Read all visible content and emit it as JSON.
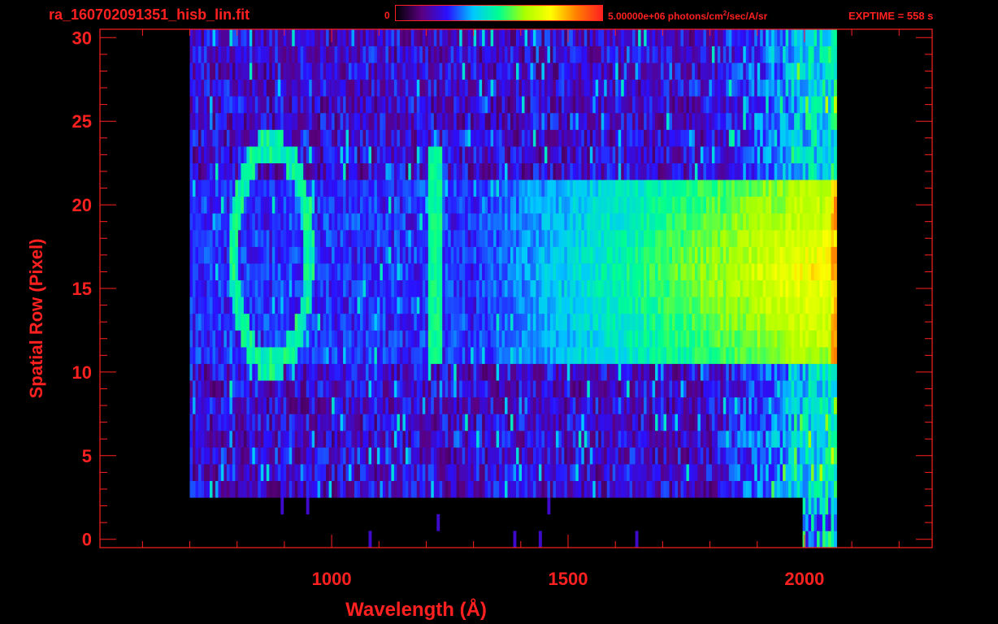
{
  "header": {
    "file_title": "ra_160702091351_hisb_lin.fit",
    "colorbar_min": "0",
    "colorbar_max_prefix": "5.00000e+06 photons/cm",
    "colorbar_max_sup": "2",
    "colorbar_max_suffix": "/sec/A/sr",
    "exptime": "EXPTIME = 558 s"
  },
  "colors": {
    "background": "#000000",
    "axes": "#ff2020",
    "colormap": [
      "#000000",
      "#5a0080",
      "#2a10ff",
      "#00c8ff",
      "#00ff90",
      "#aaff00",
      "#ffff00",
      "#ff8000",
      "#ff2020"
    ]
  },
  "chart_data": {
    "type": "heatmap",
    "title": "ra_160702091351_hisb_lin.fit",
    "xlabel": "Wavelength (Å)",
    "ylabel": "Spatial Row (Pixel)",
    "xlim": [
      510,
      2270
    ],
    "ylim": [
      -0.5,
      30.5
    ],
    "x_ticks": [
      1000,
      1500,
      2000
    ],
    "y_ticks": [
      0,
      5,
      10,
      15,
      20,
      25,
      30
    ],
    "colorbar": {
      "min": 0,
      "max": 5000000,
      "units": "photons/cm^2/sec/A/sr"
    },
    "signal_rows": [
      11,
      21
    ],
    "noise_rows": [
      3,
      30
    ],
    "data_start_wavelength": 700,
    "data_end_wavelength": 2065,
    "lines": [
      {
        "label": "ring",
        "center_wavelength": 870,
        "center_row": 17,
        "radius_wavelength": 80,
        "radius_rows": 6.5
      },
      {
        "label": "line",
        "wavelength": 1215,
        "rows": [
          11,
          23
        ]
      }
    ],
    "continuum": {
      "start_wavelength": 1300,
      "peak_wavelength": 2000,
      "rows": [
        11,
        21
      ]
    },
    "grid": false
  }
}
